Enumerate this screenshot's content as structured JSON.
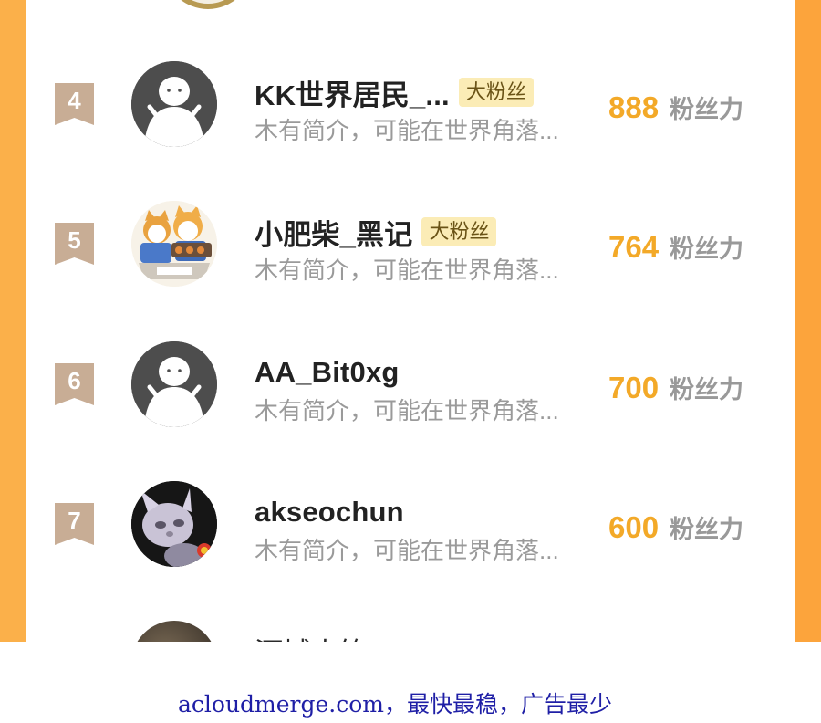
{
  "ranking": {
    "rows": [
      {
        "rank": "4",
        "name": "KK世界居民_...",
        "badge": "大粉丝",
        "bio": "木有简介，可能在世界角落...",
        "score": "888",
        "unit": "粉丝力"
      },
      {
        "rank": "5",
        "name": "小肥柴_黑记",
        "badge": "大粉丝",
        "bio": "木有简介，可能在世界角落...",
        "score": "764",
        "unit": "粉丝力"
      },
      {
        "rank": "6",
        "name": "AA_Bit0xg",
        "badge": "",
        "bio": "木有简介，可能在世界角落...",
        "score": "700",
        "unit": "粉丝力"
      },
      {
        "rank": "7",
        "name": "akseochun",
        "badge": "",
        "bio": "木有简介，可能在世界角落...",
        "score": "600",
        "unit": "粉丝力"
      }
    ],
    "partial_row_name": "河城人笛"
  },
  "colors": {
    "rank_badge": "#c8ad95",
    "score": "#f3a928",
    "frame": "#fbaa42"
  },
  "watermark": "acloudmerge.com，最快最稳，广告最少"
}
